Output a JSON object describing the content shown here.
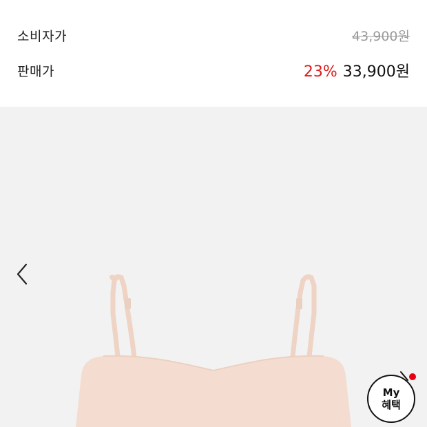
{
  "prices": {
    "consumer_label": "소비자가",
    "consumer_price": "43,900원",
    "sale_label": "판매가",
    "discount": "23%",
    "sale_price": "33,900원"
  },
  "image_viewer": {
    "prev_icon": "chevron-left-icon"
  },
  "my_benefit": {
    "line1": "My",
    "line2": "혜택",
    "indicator_color": "#e60012"
  },
  "colors": {
    "discount": "#e01a1a",
    "background": "#f2f2f2",
    "product_fabric": "#f4ddd0"
  }
}
